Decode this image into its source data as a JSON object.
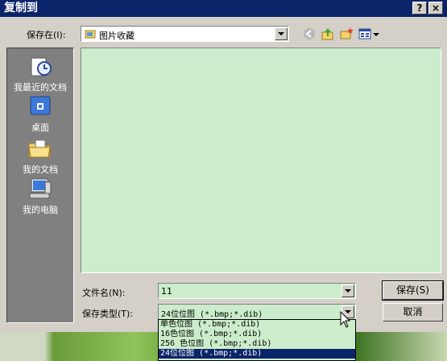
{
  "dialog": {
    "title": "复制到",
    "help_button": "?",
    "close_button": "×"
  },
  "save_in": {
    "label": "保存在(I):",
    "value": "图片收藏"
  },
  "places": [
    {
      "label": "我最近的文档",
      "icon": "recent-documents-icon"
    },
    {
      "label": "桌面",
      "icon": "desktop-icon"
    },
    {
      "label": "我的文档",
      "icon": "my-documents-icon"
    },
    {
      "label": "我的电脑",
      "icon": "my-computer-icon"
    }
  ],
  "toolbar": {
    "back_icon": "back-icon",
    "up_icon": "up-folder-icon",
    "new_folder_icon": "new-folder-icon",
    "views_icon": "views-menu-icon"
  },
  "filename": {
    "label": "文件名(N):",
    "value": "11"
  },
  "filetype": {
    "label": "保存类型(T):",
    "value": "24位位图 (*.bmp;*.dib)",
    "options": [
      "单色位图 (*.bmp;*.dib)",
      "16色位图 (*.bmp;*.dib)",
      "256 色位图 (*.bmp;*.dib)",
      "24位位图 (*.bmp;*.dib)"
    ],
    "selected_index": 3
  },
  "buttons": {
    "save": "保存(S)",
    "cancel": "取消"
  },
  "colors": {
    "title_bar": "#0a246a",
    "file_area": "#cbedcb",
    "places_bar": "#808080"
  }
}
